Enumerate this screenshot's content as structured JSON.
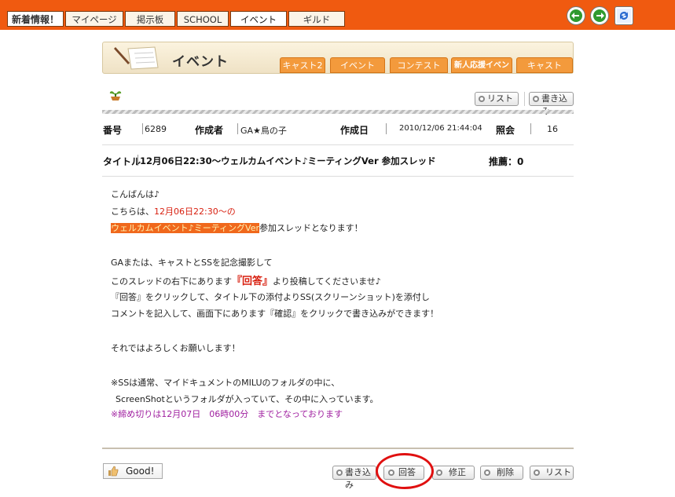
{
  "topbar": {
    "tabs": [
      {
        "label": "新着情報！"
      },
      {
        "label": "マイページ"
      },
      {
        "label": "掲示板"
      },
      {
        "label": "SCHOOL"
      },
      {
        "label": "イベント"
      },
      {
        "label": "ギルド"
      }
    ],
    "active_tab": "イベント"
  },
  "banner": {
    "title": "イベント",
    "tabs": [
      {
        "label": "キャスト2"
      },
      {
        "label": "イベント"
      },
      {
        "label": "コンテスト"
      },
      {
        "label": "新人応援イベント"
      },
      {
        "label": "キャスト"
      }
    ]
  },
  "toolbar": {
    "list_label": "リスト",
    "write_label": "書き込み"
  },
  "meta": {
    "number_label": "番号",
    "number_value": "6289",
    "author_label": "作成者",
    "author_value": "GA★鳥の子",
    "date_label": "作成日",
    "date_value": "2010/12/06 21:44:04",
    "views_label": "照会",
    "views_value": "16"
  },
  "title_row": {
    "label": "タイトル",
    "value": "12月06日22:30～ウェルカムイベント♪ミーティングVer 参加スレッド",
    "recommend": "推薦：0"
  },
  "body": {
    "l1": "こんばんは♪",
    "l2a": "こちらは、",
    "l2b": "12月06日22:30～の",
    "l3a": "ウェルカムイベント♪ミーティングVer",
    "l3b": "参加スレッドとなります！",
    "l4": "GAまたは、キャストとSSを記念撮影して",
    "l5a": "このスレッドの右下にあります",
    "l5b": "『回答』",
    "l5c": "より投稿してくださいませ♪",
    "l6": "『回答』をクリックして、タイトル下の添付よりSS(スクリーンショット)を添付し",
    "l7": "コメントを記入して、画面下にあります『確認』をクリックで書き込みができます！",
    "l8": "それではよろしくお願いします！",
    "l9": "※SSは通常、マイドキュメントのMILUのフォルダの中に、",
    "l10": "ScreenShotというフォルダが入っていて、その中に入っています。",
    "l11": "※締め切りは12月07日　06時00分　までとなっております"
  },
  "footer": {
    "good_label": "Good!",
    "write_label": "書き込み",
    "reply_label": "回答",
    "edit_label": "修正",
    "delete_label": "削除",
    "list_label": "リスト"
  },
  "colors": {
    "topbar": "#f05a10",
    "tab_orange": "#f39a3c",
    "highlight_red": "#d82010",
    "annotation_circle": "#e01010"
  }
}
